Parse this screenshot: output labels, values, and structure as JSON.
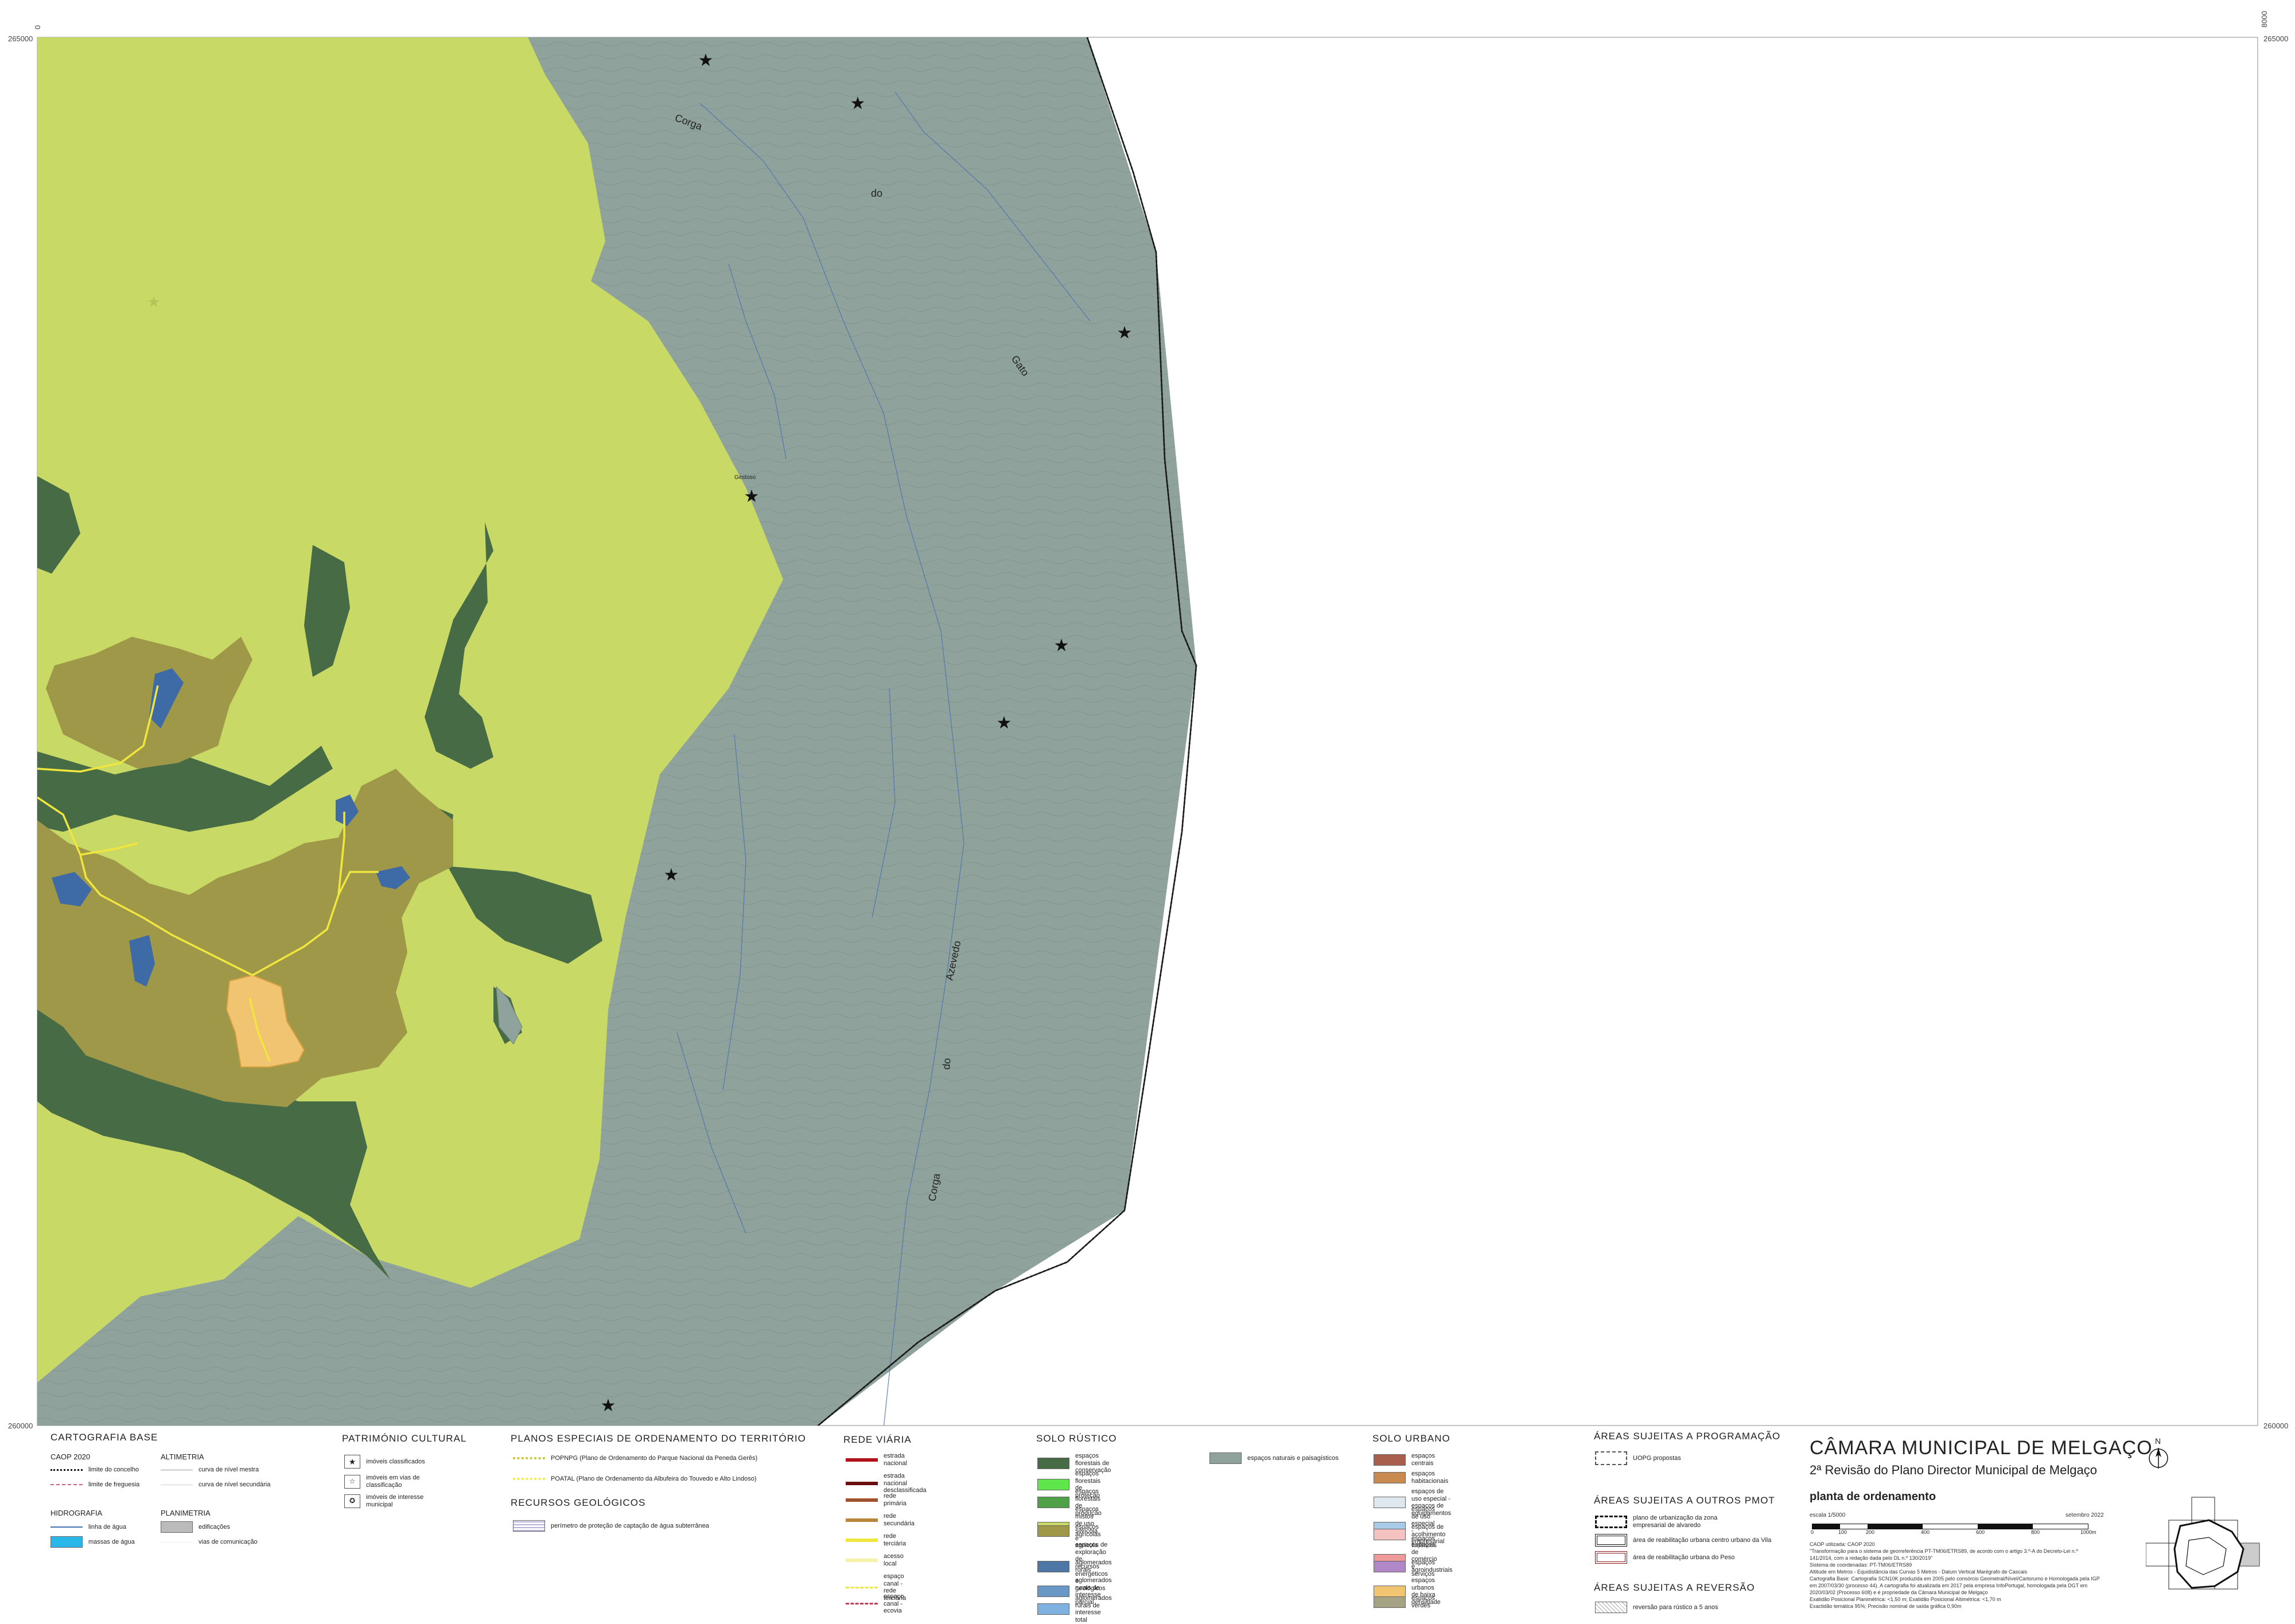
{
  "map": {
    "coords": {
      "top_left": "265000",
      "top_right": "265000",
      "bottom_left": "260000",
      "bottom_right": "260000",
      "corner_top_left": "0",
      "corner_top_right": "8000",
      "corner_bottom_right": "8000"
    },
    "labels": {
      "corga_top": "Corga",
      "do_top": "do",
      "gato": "Gato",
      "gestoso": "Gestoso",
      "azevedo": "Azevedo",
      "do_bottom": "do",
      "corga_bottom": "Corga"
    },
    "colors": {
      "natural": "#8fa39c",
      "mixed": "#c8d966",
      "forest": "#476b45",
      "rural": "#9e9848",
      "urban_low": "#f0c470",
      "water": "#3e6aa5",
      "road": "#f0e63e",
      "boundary": "#1a1a1a"
    }
  },
  "legend": {
    "cartografia": {
      "title": "CARTOGRAFIA BASE",
      "caop": "CAOP 2020",
      "limite_concelho": "limite do concelho",
      "limite_freguesia": "limite de freguesia",
      "altimetria": "ALTIMETRIA",
      "curva_mestra": "curva de nível mestra",
      "curva_secundaria": "curva de nível secundária",
      "hidrografia": "HIDROGRAFIA",
      "linha_agua": "linha de água",
      "massas_agua": "massas de água",
      "planimetria": "PLANIMETRIA",
      "edificacoes": "edificações",
      "vias": "vias de comunicação"
    },
    "patrimonio": {
      "title": "PATRIMÓNIO CULTURAL",
      "classificados": "imóveis classificados",
      "em_vias": "imóveis em vias de classificação",
      "interesse_municipal": "imóveis de interesse municipal"
    },
    "planos": {
      "title": "PLANOS ESPECIAIS DE ORDENAMENTO DO TERRITÓRIO",
      "popnpg": "POPNPG (Plano de Ordenamento do Parque Nacional da Peneda Gerês)",
      "poatal": "POATAL (Plano de Ordenamento da Albufeira do Touvedo e Alto Lindoso)",
      "recursos_title": "RECURSOS GEOLÓGICOS",
      "perimetro": "perímetro de proteção de captação de água subterrânea"
    },
    "rede_viaria": {
      "title": "REDE VIÁRIA",
      "items": [
        {
          "label": "estrada nacional",
          "color": "#b0121b"
        },
        {
          "label": "estrada nacional desclassificada",
          "color": "#6b0e10"
        },
        {
          "label": "rede primária",
          "color": "#a0522d"
        },
        {
          "label": "rede secundária",
          "color": "#b8853a"
        },
        {
          "label": "rede terciária",
          "color": "#f0e63e"
        },
        {
          "label": "acesso local",
          "color": "#f7f2a8"
        },
        {
          "label": "espaço canal - rede terciária",
          "color": "#f0e63e"
        },
        {
          "label": "espaço canal - ecovia",
          "color": "#c0405a"
        }
      ]
    },
    "solo_rustico": {
      "title": "SOLO RÚSTICO",
      "items": [
        {
          "label": "espaços florestais de conservação",
          "color": "#476b45"
        },
        {
          "label": "espaços florestais de proteção",
          "color": "#5fe64a"
        },
        {
          "label": "espaços florestais de produção",
          "color": "#4fa048"
        },
        {
          "label": "espaços mistos de uso silvícola e agrícola",
          "color": "#c8d966"
        },
        {
          "label": "espaços agrícolas",
          "color": "#9e9848"
        },
        {
          "label": "espaços de exploração de recursos energéticos e geológicos",
          "color": "#7e7a7a"
        },
        {
          "label": "aglomerados rurais",
          "color": "#4f77a5"
        },
        {
          "label": "aglomerados rurais de interesse parcial",
          "color": "#6a98c6"
        },
        {
          "label": "aglomerados rurais de interesse total",
          "color": "#7fb2e0"
        }
      ],
      "natural": {
        "label": "espaços naturais e paisagísticos",
        "color": "#8fa39c"
      }
    },
    "solo_urbano": {
      "title": "SOLO URBANO",
      "items": [
        {
          "label": "espaços centrais",
          "color": "#a8604c"
        },
        {
          "label": "espaços habitacionais",
          "color": "#c88a4e"
        },
        {
          "label": "espaços de uso especial - espaços de equipamentos",
          "color": "#e0e8ef"
        },
        {
          "label": "espaços de uso especial - espaços turísticos",
          "color": "#a8cbe8"
        },
        {
          "label": "espaços de acolhimento empresarial",
          "color": "#f5c2c2"
        },
        {
          "label": "espaços de comércio e serviços",
          "color": "#ef9a9a"
        },
        {
          "label": "espaços agroindustriais",
          "color": "#b088c8"
        },
        {
          "label": "espaços urbanos de baixa densidade",
          "color": "#f0c470"
        },
        {
          "label": "espaços verdes",
          "color": "#a6a284"
        }
      ]
    },
    "programacao": {
      "title": "ÁREAS SUJEITAS A PROGRAMAÇÃO",
      "uopg": "UOPG propostas"
    },
    "outros_pmot": {
      "title": "ÁREAS SUJEITAS A OUTROS PMOT",
      "plano_urbanizacao": "plano de urbanização da zona empresarial de alvaredo",
      "reab_vila": "área de reabilitação urbana centro urbano da Vila",
      "reab_peso": "área de reabilitação urbana do Peso"
    },
    "reversao": {
      "title": "ÁREAS SUJEITAS A REVERSÃO",
      "item": "reversão para rústico a 5 anos"
    },
    "title_block": {
      "municipality": "CÂMARA MUNICIPAL DE MELGAÇO",
      "revision": "2ª Revisão do Plano Director Municipal de Melgaço",
      "plan": "planta de ordenamento",
      "escala_label": "escala",
      "escala_value": "1/5000",
      "date": "setembro 2022",
      "scale_ticks": [
        "0",
        "100",
        "200",
        "400",
        "600",
        "800",
        "1000m"
      ],
      "notes": [
        "CAOP utilizada: CAOP 2020",
        "\"Transformação para o sistema de georreferência PT-TM06/ETRS89, de acordo com o artigo 3.º-A do Decreto-Lei n.º",
        "141/2014, com a redação dada pelo DL n.º 130/2019\"",
        "Sistema de coordenadas: PT-TM06/ETRS89",
        "Altitude em Metros - Equidistância das Curvas 5 Metros - Datum Vertical Marégrafo de Cascais",
        "Cartografia Base: Cartografia SCN10K produzida em 2005 pelo consórcio Geometral/Nível/Cartorumo e Homologada pela IGP",
        "em 2007/03/30 (processo 44). A cartografia foi atualizada em 2017 pela empresa InfoPortugal, homologada pela DGT em",
        "2020/03/02 (Processo 608) e é propriedade da Câmara Municipal de Melgaço",
        "Exatidão Posicional Planimétrica: <1,50 m; Exatidão Posicional Altimétrica: <1,70 m",
        "Exactidão temática 95%; Precisão nominal de saída gráfica 0,90m"
      ],
      "north": "N"
    }
  }
}
